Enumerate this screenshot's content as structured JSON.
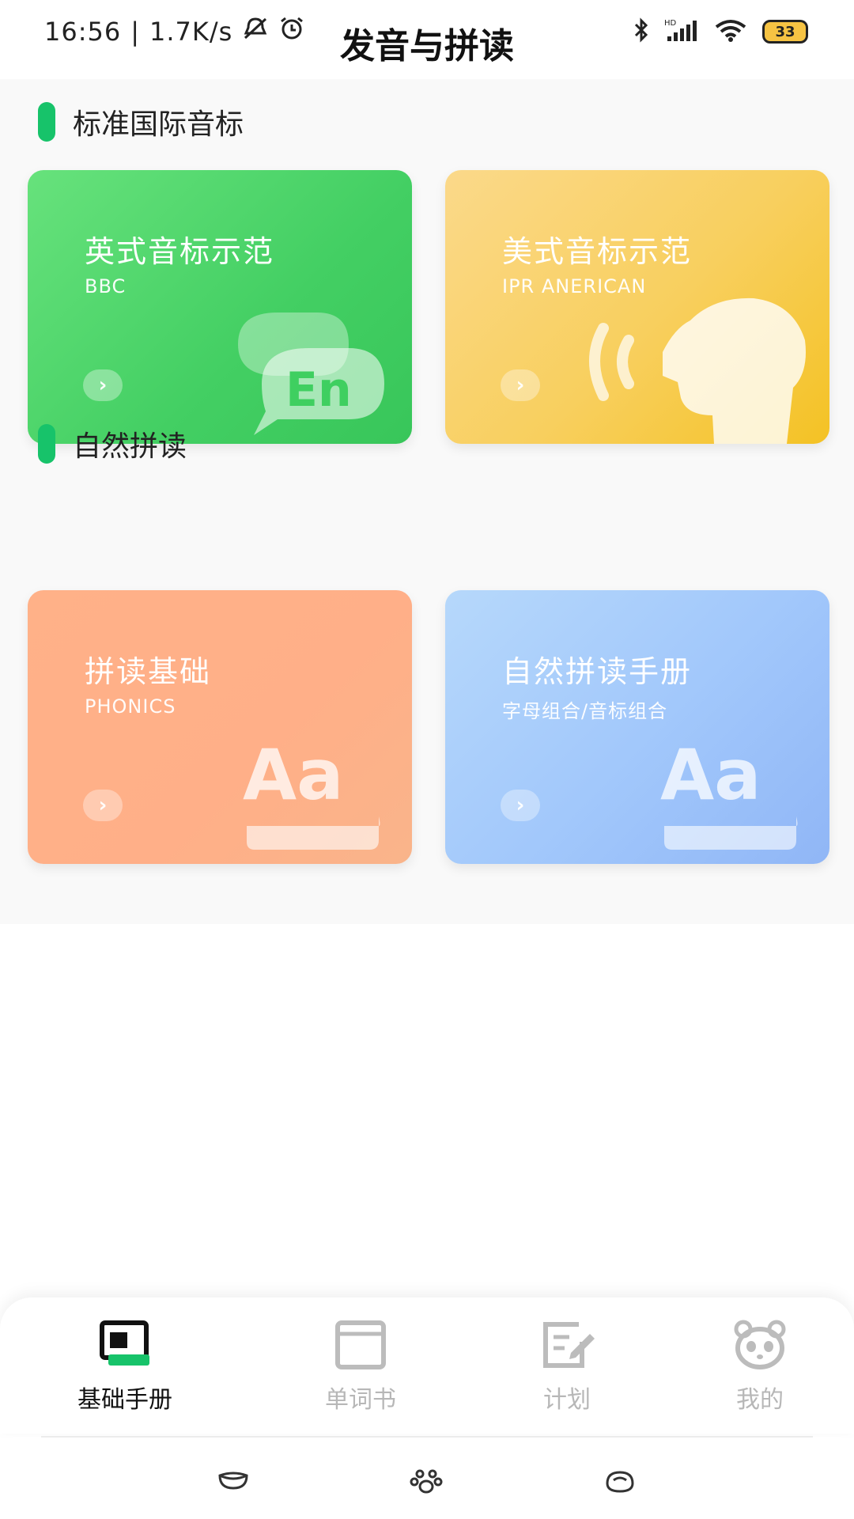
{
  "status_bar": {
    "time": "16:56",
    "speed": "1.7K/s",
    "battery": "33"
  },
  "header": {
    "title": "发音与拼读"
  },
  "sections": [
    {
      "title": "标准国际音标"
    },
    {
      "title": "自然拼读"
    }
  ],
  "cards": [
    {
      "title": "英式音标示范",
      "subtitle": "BBC",
      "color": "#4fd86a",
      "icon": "speech-bubble-en-icon",
      "icon_text": "En"
    },
    {
      "title": "美式音标示范",
      "subtitle": "IPR ANERICAN",
      "color": "#f8cf5e",
      "icon": "speaking-head-icon"
    },
    {
      "title": "拼读基础",
      "subtitle": "PHONICS",
      "color": "#ffb188",
      "icon": "letters-aa-icon",
      "icon_text": "Aa"
    },
    {
      "title": "自然拼读手册",
      "subtitle": "字母组合/音标组合",
      "color": "#a1c7fb",
      "icon": "letters-aa-icon",
      "icon_text": "Aa"
    }
  ],
  "bottom_nav": {
    "items": [
      {
        "label": "基础手册",
        "icon": "book-icon",
        "active": true
      },
      {
        "label": "单词书",
        "icon": "notebook-icon",
        "active": false
      },
      {
        "label": "计划",
        "icon": "plan-edit-icon",
        "active": false
      },
      {
        "label": "我的",
        "icon": "panda-icon",
        "active": false
      }
    ]
  },
  "accent_color": "#17c36a"
}
